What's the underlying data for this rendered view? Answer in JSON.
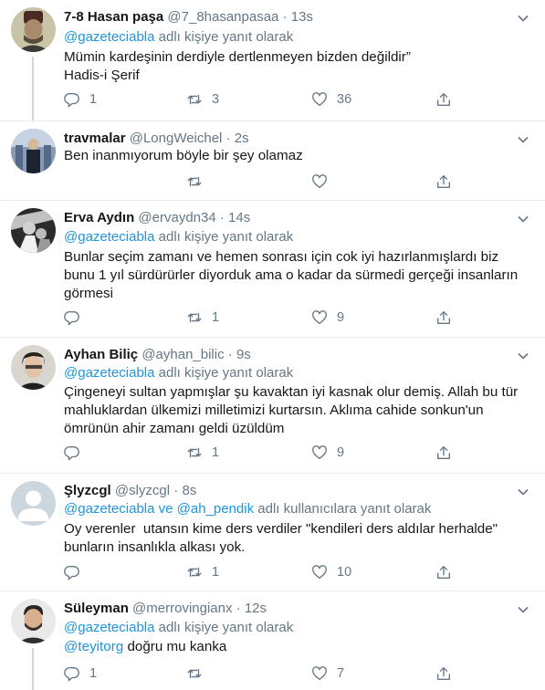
{
  "colors": {
    "accent": "#1b95e0",
    "secondary_text": "#657786",
    "divider": "#e6ecf0"
  },
  "tweets": [
    {
      "name": "7-8 Hasan paşa",
      "handle": "@7_8hasanpasaa",
      "sep": "·",
      "time": "13s",
      "reply_mention": "@gazeteciabla",
      "reply_suffix": " adlı kişiye yanıt olarak",
      "lines": [
        "Mümin kardeşinin derdiyle dertlenmeyen bizden değildir”",
        "Hadis-i Şerif"
      ],
      "replies": "1",
      "retweets": "3",
      "likes": "36"
    },
    {
      "name": "travmalar",
      "handle": "@LongWeichel",
      "sep": "·",
      "time": "2s",
      "lines": [
        "Ben inanmıyorum böyle bir şey olamaz"
      ],
      "replies": "",
      "retweets": "",
      "likes": ""
    },
    {
      "name": "Erva Aydın",
      "handle": "@ervaydn34",
      "sep": "·",
      "time": "14s",
      "reply_mention": "@gazeteciabla",
      "reply_suffix": " adlı kişiye yanıt olarak",
      "lines": [
        "Bunlar seçim zamanı ve hemen sonrası için cok iyi hazırlanmışlardı biz",
        "bunu 1 yıl sürdürürler diyorduk ama o kadar da sürmedi gerçeği insanların",
        "görmesi"
      ],
      "replies": "",
      "retweets": "1",
      "likes": "9"
    },
    {
      "name": "Ayhan Biliç",
      "handle": "@ayhan_bilic",
      "sep": "·",
      "time": "9s",
      "reply_mention": "@gazeteciabla",
      "reply_suffix": " adlı kişiye yanıt olarak",
      "lines": [
        "Çingeneyi sultan yapmışlar şu kavaktan iyi kasnak olur demiş. Allah bu tür",
        "mahluklardan ülkemizi milletimizi kurtarsın. Aklıma cahide sonkun'un",
        "ömrünün ahir zamanı geldi üzüldüm"
      ],
      "replies": "",
      "retweets": "1",
      "likes": "9"
    },
    {
      "name": "Şlyzcgl",
      "handle": "@slyzcgl",
      "sep": "·",
      "time": "8s",
      "reply_mention": "@gazeteciabla",
      "reply_joiner": " ve ",
      "reply_mention2": "@ah_pendik",
      "reply_suffix": " adlı kullanıcılara yanıt olarak",
      "lines": [
        "Oy verenler  utansın kime ders verdiler \"kendileri ders aldılar herhalde\"",
        "bunların insanlıkla alkası yok."
      ],
      "replies": "",
      "retweets": "1",
      "likes": "10"
    },
    {
      "name": "Süleyman",
      "handle": "@merrovingianx",
      "sep": "·",
      "time": "12s",
      "reply_mention": "@gazeteciabla",
      "reply_suffix": " adlı kişiye yanıt olarak",
      "text_mention": "@teyitorg",
      "lines": [
        " doğru mu kanka"
      ],
      "replies": "1",
      "retweets": "",
      "likes": "7"
    }
  ]
}
